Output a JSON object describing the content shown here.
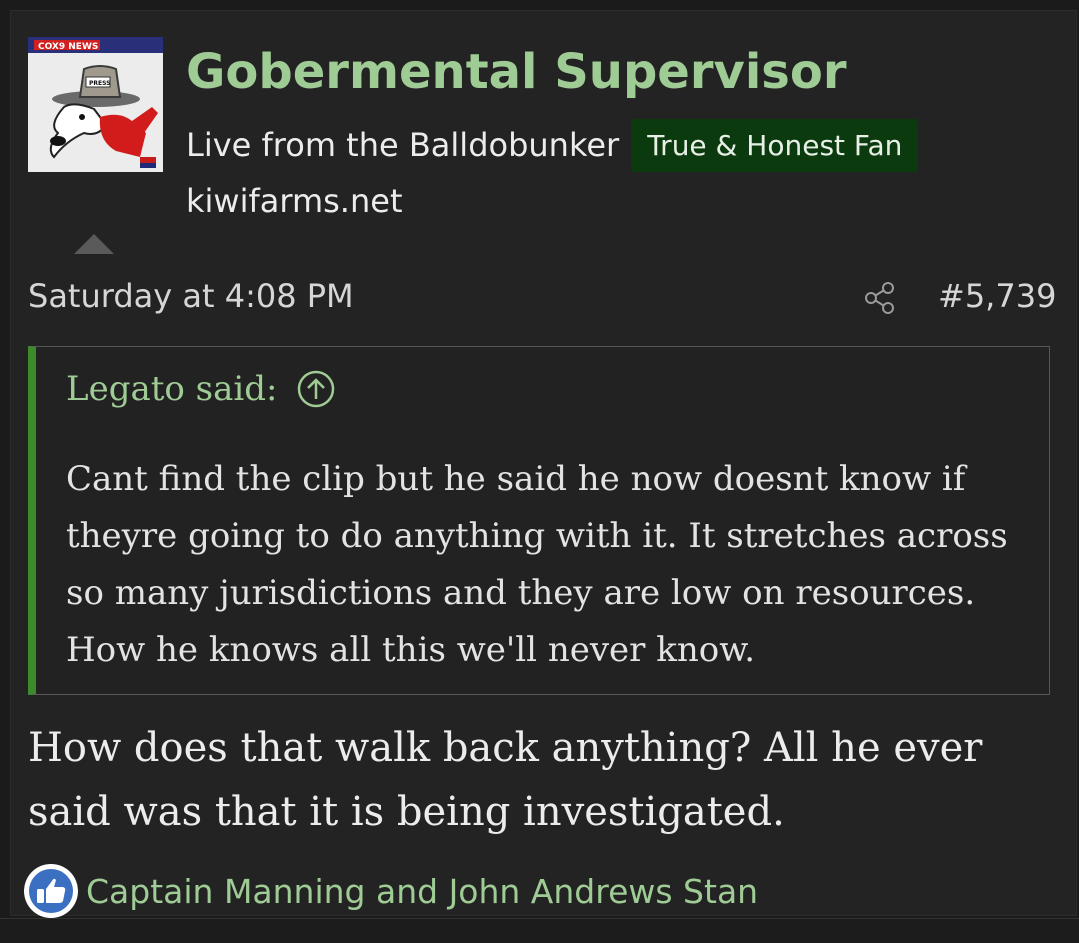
{
  "author": {
    "avatar_name": "avatar",
    "username": "Gobermental Supervisor",
    "user_title": "Live from the Balldobunker",
    "banner": "True & Honest Fan",
    "website": "kiwifarms.net",
    "avatar_logo_text": "COX9 NEWS",
    "avatar_hat_text": "PRESS"
  },
  "post": {
    "date": "Saturday at 4:08 PM",
    "number": "#5,739",
    "share_icon": "share-icon"
  },
  "quote": {
    "attribution": "Legato said:",
    "jump_icon": "arrow-up-circle-icon",
    "text": "Cant find the clip but he said he now doesnt know if theyre going to do anything with it. It stretches across so many jurisdictions and they are low on resources. How he knows all this we'll never know."
  },
  "body": {
    "text": "How does that walk back anything? All he ever said was that it is being investigated."
  },
  "reactions": {
    "icon": "like-icon",
    "users": "Captain Manning and John Andrews Stan"
  },
  "colors": {
    "accent_green": "#9fcb95",
    "banner_bg": "#0a3a0e",
    "quote_bar": "#3d8a2c"
  }
}
